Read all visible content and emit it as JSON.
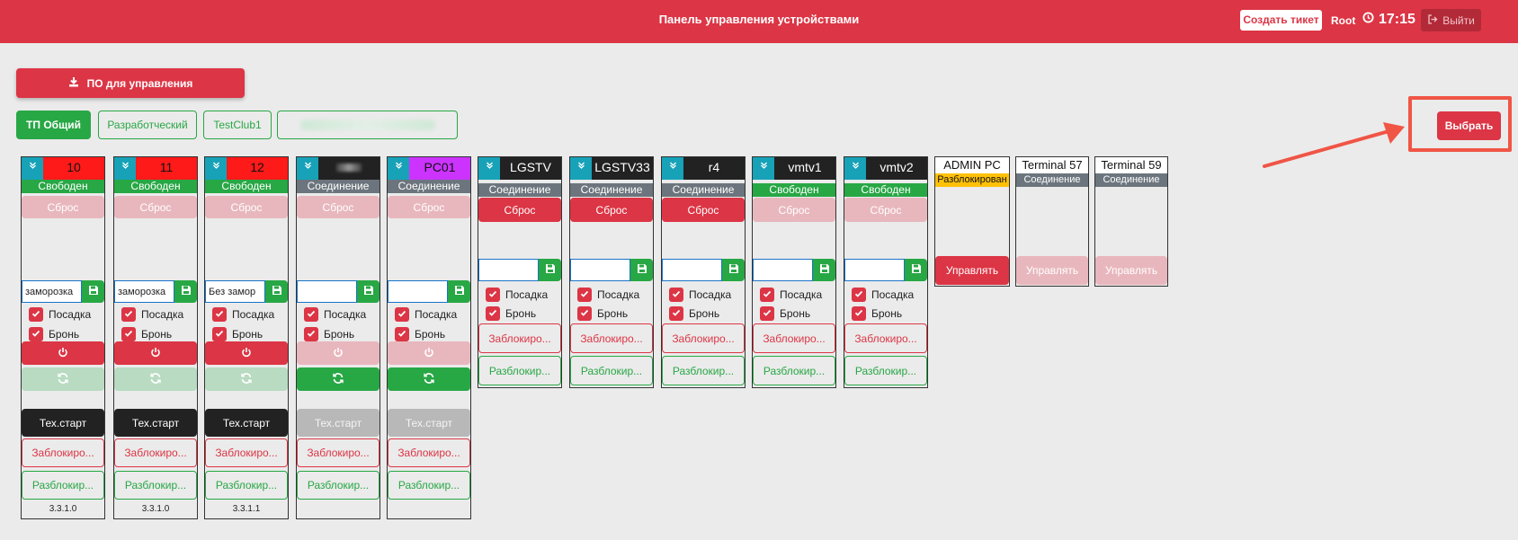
{
  "header": {
    "title": "Панель управления устройствами",
    "ticket_label": "Создать тикет",
    "user": "Root",
    "time": "17:15",
    "logout_label": "Выйти"
  },
  "download_label": "ПО для управления",
  "groups": [
    {
      "label": "ТП Общий",
      "active": true
    },
    {
      "label": "Разработческий",
      "active": false
    },
    {
      "label": "TestClub1",
      "active": false
    },
    {
      "label": "",
      "active": false,
      "blurred": true
    }
  ],
  "select_label": "Выбрать",
  "labels": {
    "reset": "Сброс",
    "boarding": "Посадка",
    "reservation": "Бронь",
    "block": "Заблокиро...",
    "unblock": "Разблокир...",
    "techstart": "Тех.старт",
    "manage": "Управлять"
  },
  "devices": [
    {
      "name": "10",
      "status": "Свободен",
      "input": "заморозка",
      "version": "3.3.1.0"
    },
    {
      "name": "11",
      "status": "Свободен",
      "input": "заморозка",
      "version": "3.3.1.0"
    },
    {
      "name": "12",
      "status": "Свободен",
      "input": "Без замор",
      "version": "3.3.1.1"
    },
    {
      "name": "",
      "status": "Соединение",
      "input": "",
      "version": ""
    },
    {
      "name": "PC01",
      "status": "Соединение",
      "input": "",
      "version": ""
    },
    {
      "name": "LGSTV",
      "status": "Соединение",
      "input": ""
    },
    {
      "name": "LGSTV33",
      "status": "Соединение",
      "input": ""
    },
    {
      "name": "r4",
      "status": "Соединение",
      "input": ""
    },
    {
      "name": "vmtv1",
      "status": "Свободен",
      "input": ""
    },
    {
      "name": "vmtv2",
      "status": "Свободен",
      "input": ""
    },
    {
      "name": "ADMIN PC",
      "status": "Разблокирован"
    },
    {
      "name": "Terminal 57",
      "status": "Соединение"
    },
    {
      "name": "Terminal 59",
      "status": "Соединение"
    }
  ],
  "colors": {
    "accent": "#dc3545",
    "success": "#28a745",
    "info": "#17a2b8",
    "secondary": "#6c757d",
    "warning": "#ffc107",
    "pc_head_red": "#ff1a1a",
    "pc_head_magenta": "#cc33ff",
    "pc_head_dark": "#222222"
  },
  "icons": {
    "download": "download-icon",
    "clock": "clock-icon",
    "logout": "sign-out-icon",
    "expand": "chevron-down-icon",
    "save": "floppy-icon",
    "check": "check-icon",
    "power": "power-icon",
    "refresh": "refresh-icon"
  }
}
